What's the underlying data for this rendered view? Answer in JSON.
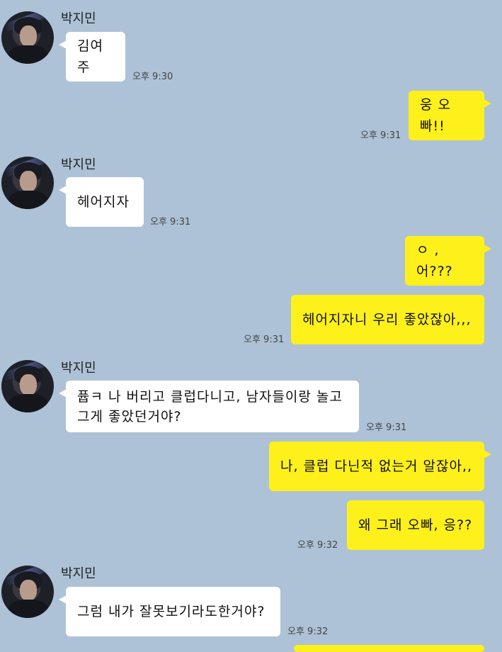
{
  "sender_name": "박지민",
  "messages": [
    {
      "text": "김여주",
      "time": "오후 9:30"
    },
    {
      "text": "웅 오빠!!",
      "time": "오후 9:31"
    },
    {
      "text": "헤어지자",
      "time": "오후 9:31"
    },
    {
      "text": "ㅇ , 어???"
    },
    {
      "text": "헤어지자니 우리 좋았잖아,,,",
      "time": "오후 9:31"
    },
    {
      "line1": "퓹ㅋ 나 버리고 클럽다니고, 남자들이랑 놀고",
      "line2": "그게 좋았던거야?",
      "time": "오후 9:31"
    },
    {
      "text": "나, 클럽 다닌적 없는거 알잖아,,"
    },
    {
      "text": "왜 그래 오빠, 응??",
      "time": "오후 9:32"
    },
    {
      "text": "그럼 내가 잘못보기라도한거야?",
      "time": "오후 9:32"
    }
  ]
}
